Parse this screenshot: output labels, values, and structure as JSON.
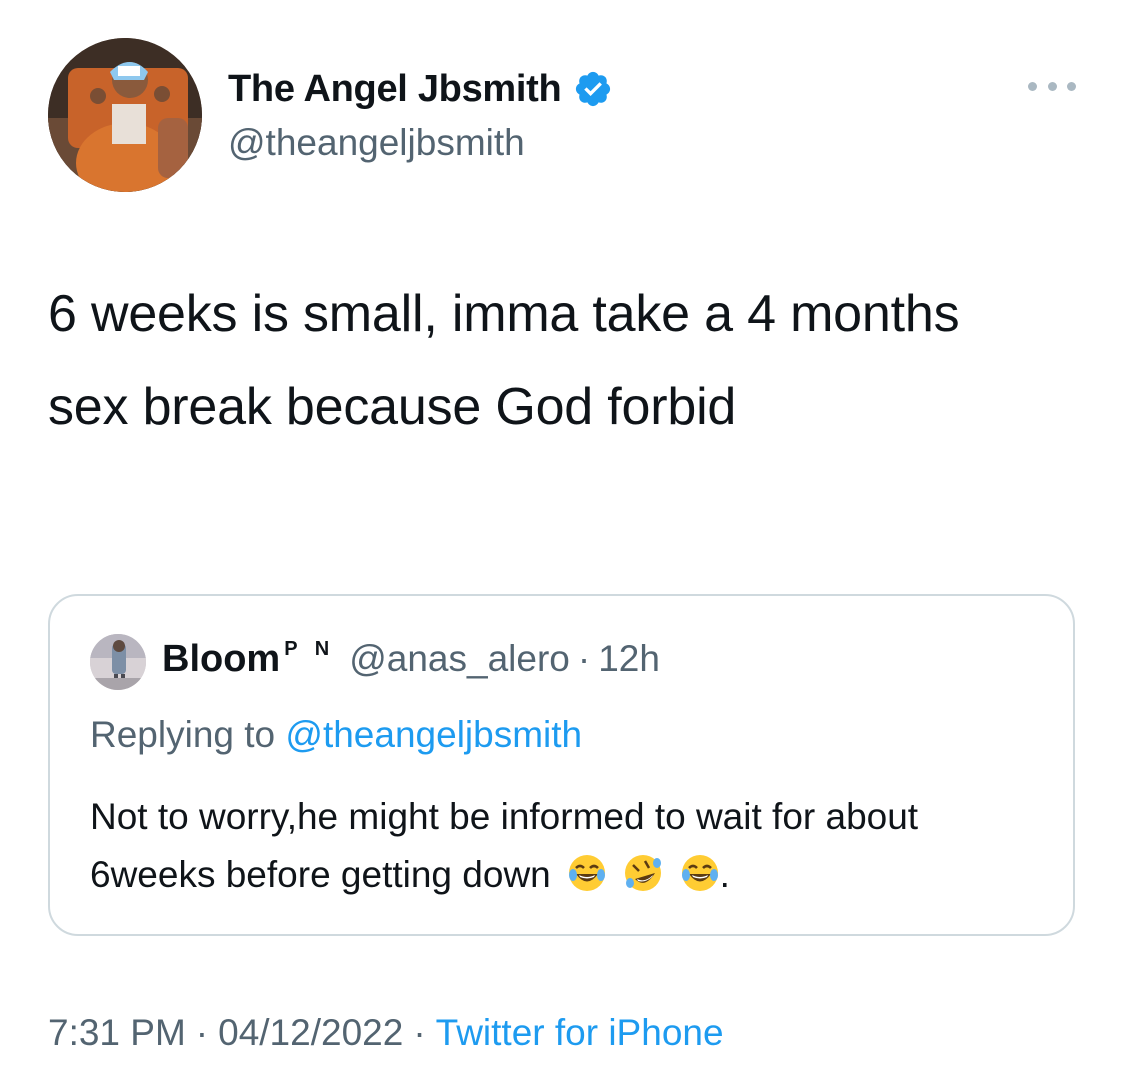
{
  "author": {
    "display_name": "The Angel Jbsmith",
    "handle": "@theangeljbsmith",
    "verified": true
  },
  "tweet": {
    "text": "6 weeks is small, imma take a 4 months sex break because God forbid"
  },
  "quoted_tweet": {
    "display_name": "Bloom",
    "name_suffix": "P N",
    "handle": "@anas_alero",
    "separator": "·",
    "time": "12h",
    "replying_prefix": "Replying to",
    "replying_handle": "@theangeljbsmith",
    "text": "Not to worry,he might be informed to wait for about 6weeks before getting down",
    "emojis": [
      "face-with-tears-of-joy",
      "rolling-on-floor-laughing",
      "face-with-tears-of-joy"
    ],
    "trailing": "."
  },
  "footer": {
    "time": "7:31 PM",
    "separator": "·",
    "date": "04/12/2022",
    "source": "Twitter for iPhone"
  },
  "colors": {
    "text_primary": "#0f1419",
    "text_secondary": "#536471",
    "link": "#1d9bf0",
    "border": "#cfd9de",
    "verified_badge": "#1d9bf0"
  }
}
